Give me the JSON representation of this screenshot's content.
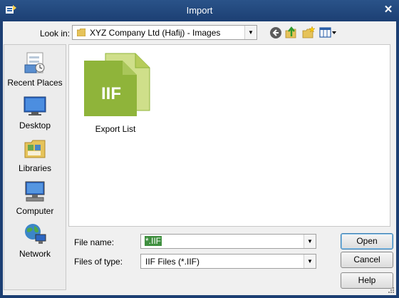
{
  "window": {
    "title": "Import"
  },
  "toolbar": {
    "look_in_label": "Look in:",
    "look_in_value": "XYZ Company Ltd (Hafij) - Images",
    "icons": [
      "back-icon",
      "up-folder-icon",
      "new-folder-icon",
      "view-menu-icon"
    ]
  },
  "places": [
    {
      "label": "Recent Places",
      "icon": "recent-places-icon"
    },
    {
      "label": "Desktop",
      "icon": "desktop-icon"
    },
    {
      "label": "Libraries",
      "icon": "libraries-icon"
    },
    {
      "label": "Computer",
      "icon": "computer-icon"
    },
    {
      "label": "Network",
      "icon": "network-icon"
    }
  ],
  "files": [
    {
      "name": "Export List",
      "icon_text": "IIF",
      "icon": "iif-file-icon"
    }
  ],
  "form": {
    "file_name_label": "File name:",
    "file_name_value": "*.IIF",
    "files_of_type_label": "Files of type:",
    "files_of_type_value": "IIF Files (*.IIF)"
  },
  "buttons": {
    "open": "Open",
    "cancel": "Cancel",
    "help": "Help"
  },
  "colors": {
    "titlebar": "#1c3f73",
    "accent_green": "#8fb43a",
    "selection": "#3f8f3f"
  }
}
